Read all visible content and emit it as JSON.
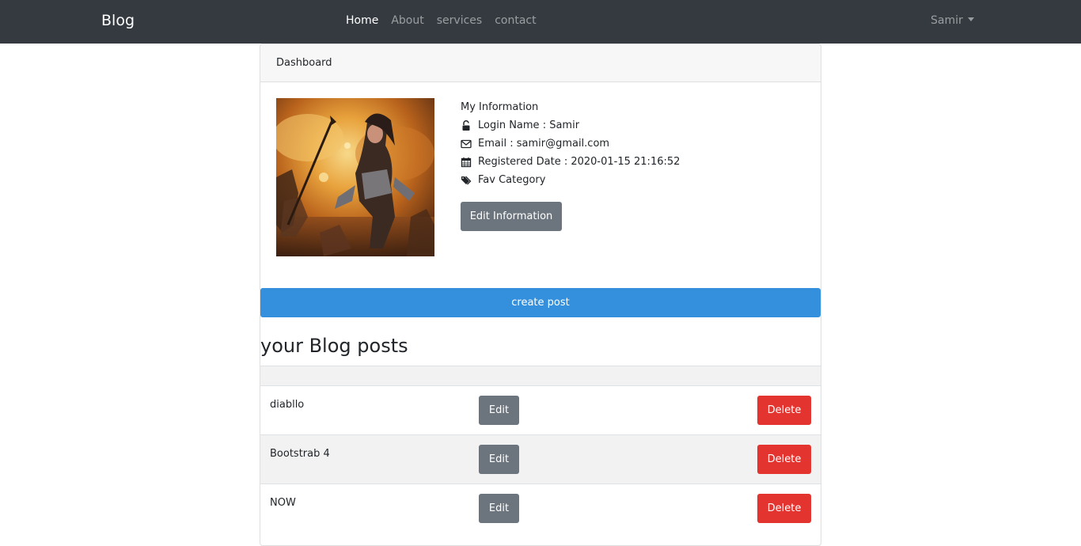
{
  "navbar": {
    "brand": "Blog",
    "links": [
      {
        "label": "Home",
        "active": true
      },
      {
        "label": "About",
        "active": false
      },
      {
        "label": "services",
        "active": false
      },
      {
        "label": "contact",
        "active": false
      }
    ],
    "user": "Samir"
  },
  "card": {
    "header": "Dashboard",
    "profile_image_icon": "fantasy-warrior-avatar",
    "info": {
      "title": "My Information",
      "login_name": "Login Name : Samir",
      "email": "Email : samir@gmail.com",
      "registered": "Registered Date : 2020-01-15 21:16:52",
      "fav_category": "Fav Category"
    },
    "edit_button": "Edit Information",
    "create_post_button": "create post",
    "posts_heading": "your Blog posts"
  },
  "posts": [
    {
      "title": "diabllo",
      "edit": "Edit",
      "delete": "Delete"
    },
    {
      "title": "Bootstrab 4",
      "edit": "Edit",
      "delete": "Delete"
    },
    {
      "title": "NOW",
      "edit": "Edit",
      "delete": "Delete"
    }
  ],
  "colors": {
    "navbar_bg": "#343a40",
    "primary": "#3490dc",
    "secondary": "#6c757d",
    "danger": "#e3342f"
  }
}
